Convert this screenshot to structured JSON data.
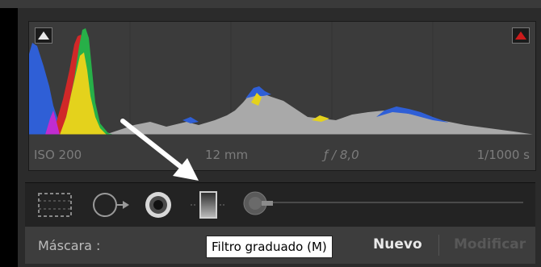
{
  "histogram": {
    "exif": {
      "iso": "ISO 200",
      "focal_length": "12 mm",
      "aperture": "ƒ / 8,0",
      "shutter": "1/1000 s"
    },
    "clipping": {
      "shadow_icon": "triangle-up-icon",
      "highlight_icon": "triangle-up-icon",
      "highlight_color": "#cc1b1b"
    }
  },
  "tools": [
    {
      "name": "crop-overlay",
      "icon": "crop-icon"
    },
    {
      "name": "spot-removal",
      "icon": "spot-removal-icon"
    },
    {
      "name": "red-eye",
      "icon": "red-eye-icon"
    },
    {
      "name": "graduated-filter",
      "icon": "graduated-filter-icon"
    },
    {
      "name": "adjustment-brush",
      "icon": "adjustment-brush-icon"
    }
  ],
  "mask": {
    "label": "Máscara :",
    "new_label": "Nuevo",
    "modify_label": "Modificar"
  },
  "tooltip": "Filtro graduado (M)",
  "colors": {
    "panel_bg": "#2b2b2b",
    "histogram_bg": "#3b3b3b",
    "mask_bg": "#3d3d3d"
  }
}
